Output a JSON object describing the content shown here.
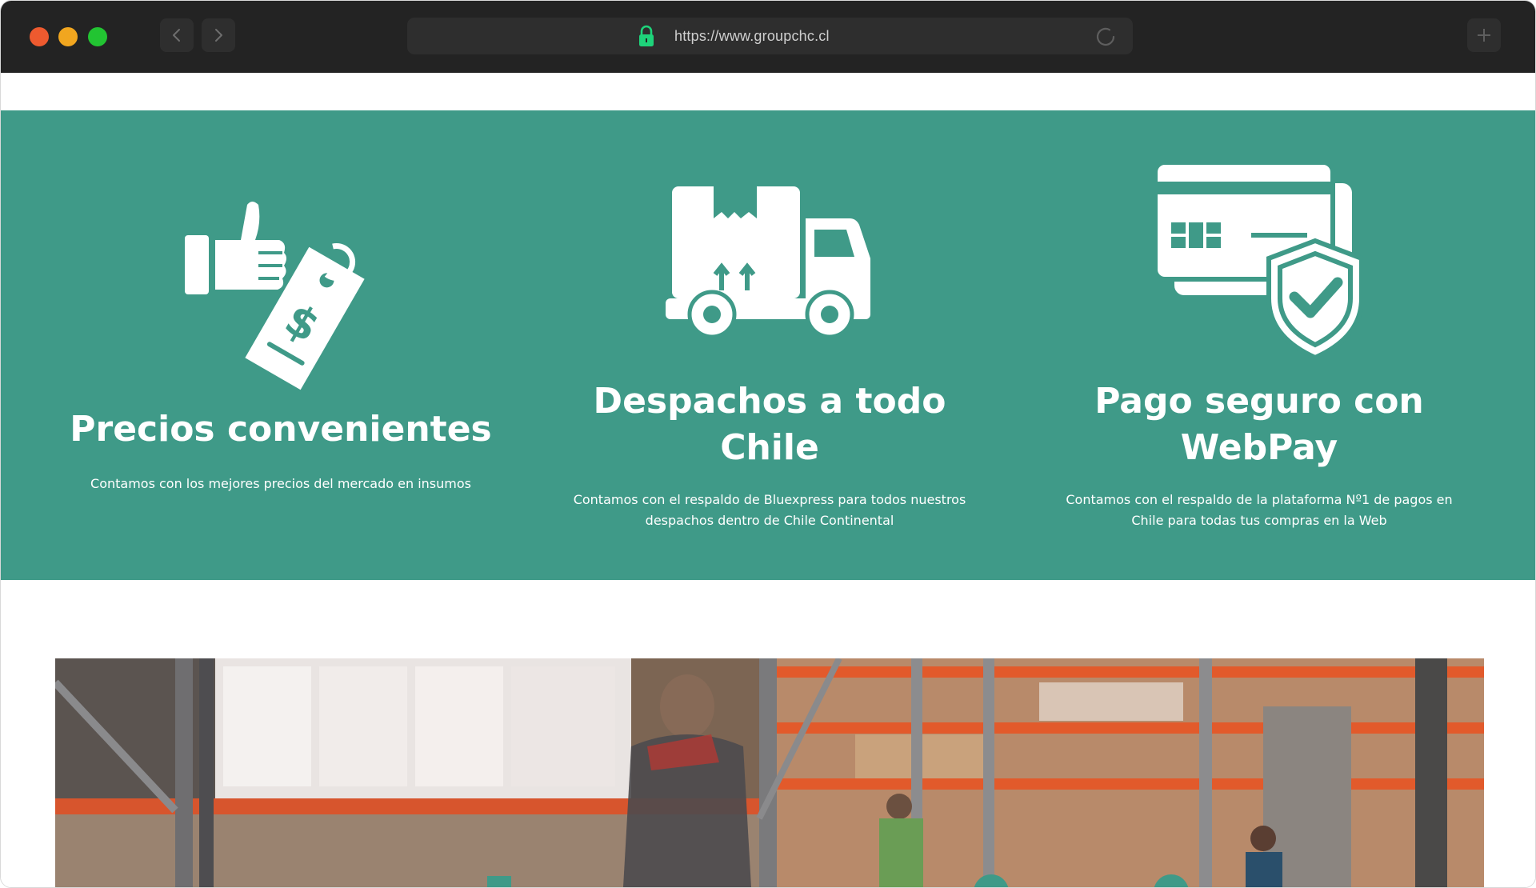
{
  "browser": {
    "url": "https://www.groupchc.cl"
  },
  "features": [
    {
      "icon": "thumbs-up-price-tag-icon",
      "title": "Precios convenientes",
      "description": "Contamos con los mejores precios del mercado en insumos"
    },
    {
      "icon": "delivery-truck-icon",
      "title": "Despachos a todo Chile",
      "description": "Contamos con el respaldo de Bluexpress para todos nuestros despachos dentro de Chile Continental"
    },
    {
      "icon": "credit-card-shield-icon",
      "title": "Pago seguro con WebPay",
      "description": "Contamos con el respaldo de la plataforma Nº1 de pagos en Chile para todas tus compras en la Web"
    }
  ],
  "colors": {
    "feature_band": "#3f9a88",
    "titlebar": "#232323",
    "url_field": "#2e2e2e"
  },
  "hero": {
    "image": "warehouse-photo"
  }
}
